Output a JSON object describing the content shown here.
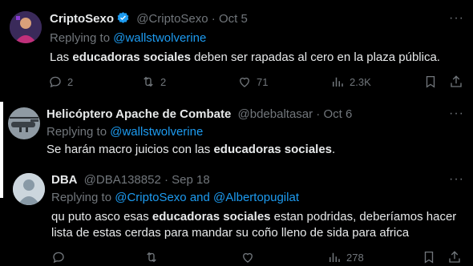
{
  "tweet1": {
    "name": "CriptoSexo",
    "handle": "@CriptoSexo",
    "date": "Oct 5",
    "replying_prefix": "Replying to ",
    "replying_to": "@wallstwolverine",
    "text_a": "Las ",
    "text_b": "educadoras sociales",
    "text_c": " deben ser rapadas al cero en la plaza pública.",
    "replies": "2",
    "retweets": "2",
    "likes": "71",
    "views": "2.3K",
    "more": "···"
  },
  "tweet2": {
    "name": "Helicóptero Apache de Combate",
    "handle": "@bdebaltasar",
    "date": "Oct 6",
    "replying_prefix": "Replying to ",
    "replying_to": "@wallstwolverine",
    "text_a": "Se harán macro juicios con las ",
    "text_b": "educadoras sociales",
    "text_c": ".",
    "more": "···"
  },
  "tweet3": {
    "name": "DBA",
    "handle": "@DBA138852",
    "date": "Sep 18",
    "replying_prefix": "Replying to ",
    "replying_to_1": "@CriptoSexo",
    "replying_and": " and ",
    "replying_to_2": "@Albertopugilat",
    "line1_a": "qu puto asco esas ",
    "line1_b": "educadoras sociales",
    "line1_c": " estan podridas, deberíamos hacer",
    "line2": "lista de estas cerdas para mandar su coño lleno de sida para africa",
    "partial_views": "278",
    "more": "···"
  },
  "colors": {
    "link": "#1d9bf0",
    "muted": "#71767b",
    "text": "#e7e9ea",
    "verified": "#1d9bf0"
  }
}
